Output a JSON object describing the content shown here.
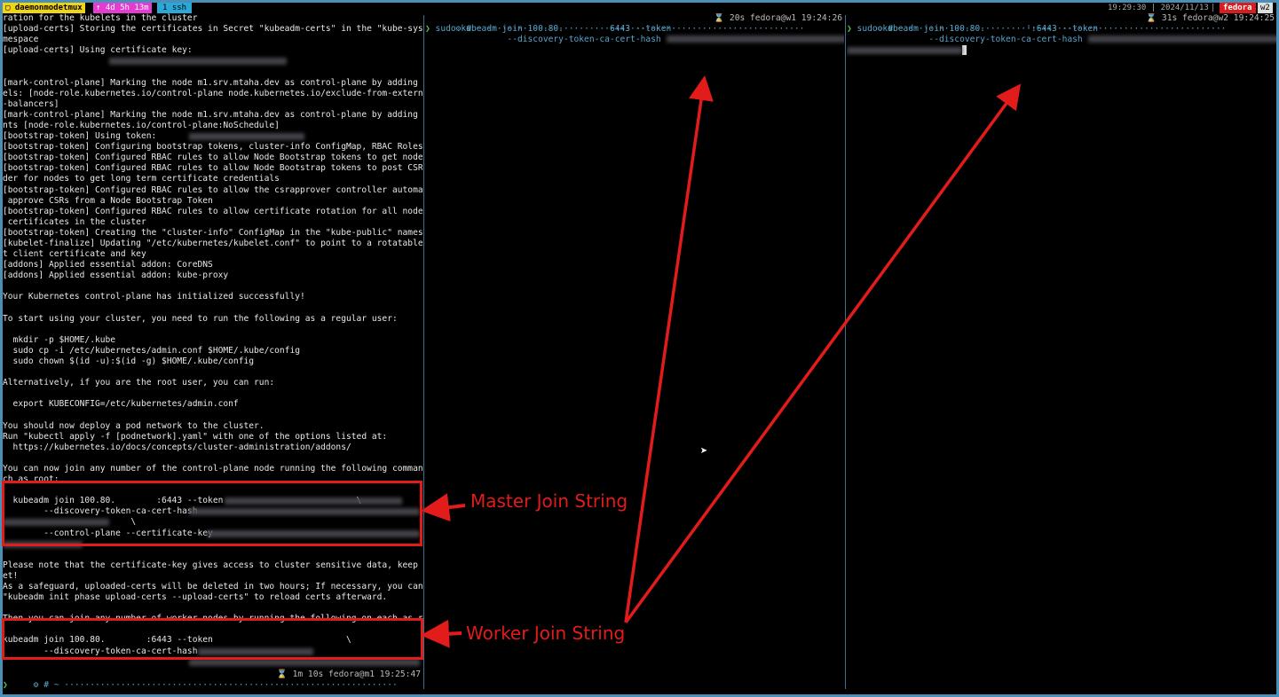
{
  "status_bar": {
    "session": "▢ daemonmodetmux",
    "uptime": "↑ 4d 5h 13m",
    "window": "1 ssh",
    "time": "19:29:30 | 2024/11/13",
    "separator": "|",
    "host": "fedora",
    "window2": "w2"
  },
  "left_pane": {
    "lines": [
      "ration for the kubelets in the cluster",
      "[upload-certs] Storing the certificates in Secret \"kubeadm-certs\" in the \"kube-system\" Na",
      "mespace",
      "[upload-certs] Using certificate key:",
      "",
      "",
      "[mark-control-plane] Marking the node m1.srv.mtaha.dev as control-plane by adding the lab",
      "els: [node-role.kubernetes.io/control-plane node.kubernetes.io/exclude-from-external-load",
      "-balancers]",
      "[mark-control-plane] Marking the node m1.srv.mtaha.dev as control-plane by adding the tai",
      "nts [node-role.kubernetes.io/control-plane:NoSchedule]",
      "[bootstrap-token] Using token:",
      "[bootstrap-token] Configuring bootstrap tokens, cluster-info ConfigMap, RBAC Roles",
      "[bootstrap-token] Configured RBAC rules to allow Node Bootstrap tokens to get nodes",
      "[bootstrap-token] Configured RBAC rules to allow Node Bootstrap tokens to post CSRs in or",
      "der for nodes to get long term certificate credentials",
      "[bootstrap-token] Configured RBAC rules to allow the csrapprover controller automatically",
      " approve CSRs from a Node Bootstrap Token",
      "[bootstrap-token] Configured RBAC rules to allow certificate rotation for all node client",
      " certificates in the cluster",
      "[bootstrap-token] Creating the \"cluster-info\" ConfigMap in the \"kube-public\" namespace",
      "[kubelet-finalize] Updating \"/etc/kubernetes/kubelet.conf\" to point to a rotatable kubele",
      "t client certificate and key",
      "[addons] Applied essential addon: CoreDNS",
      "[addons] Applied essential addon: kube-proxy",
      "",
      "Your Kubernetes control-plane has initialized successfully!",
      "",
      "To start using your cluster, you need to run the following as a regular user:",
      "",
      "  mkdir -p $HOME/.kube",
      "  sudo cp -i /etc/kubernetes/admin.conf $HOME/.kube/config",
      "  sudo chown $(id -u):$(id -g) $HOME/.kube/config",
      "",
      "Alternatively, if you are the root user, you can run:",
      "",
      "  export KUBECONFIG=/etc/kubernetes/admin.conf",
      "",
      "You should now deploy a pod network to the cluster.",
      "Run \"kubectl apply -f [podnetwork].yaml\" with one of the options listed at:",
      "  https://kubernetes.io/docs/concepts/cluster-administration/addons/",
      "",
      "You can now join any number of the control-plane node running the following command on ea",
      "ch as root:",
      "",
      "  kubeadm join 100.80.        :6443 --token                          \\",
      "        --discovery-token-ca-cert-hash",
      "                         \\",
      "        --control-plane --certificate-key",
      "",
      "",
      "Please note that the certificate-key gives access to cluster sensitive data, keep it secr",
      "et!",
      "As a safeguard, uploaded-certs will be deleted in two hours; If necessary, you can use",
      "\"kubeadm init phase upload-certs --upload-certs\" to reload certs afterward.",
      "",
      "Then you can join any number of worker nodes by running the following on each as root:",
      "",
      "kubeadm join 100.80.        :6443 --token                          \\",
      "        --discovery-token-ca-cert-hash",
      ""
    ],
    "prompt_left": "⚙ # ~ ·································································",
    "prompt_right": "⌛ 1m 10s fedora@m1 19:25:47",
    "chevron": "❯"
  },
  "mid_pane": {
    "prompt_left": "⚙ # ~ ······························································",
    "prompt_right": "⌛ 20s fedora@w1 19:24:26",
    "chevron": "❯",
    "cmd1": " sudo kubeadm join 100.80.         6443 --token                                     \\",
    "cmd2": "                --discovery-token-ca-cert-hash"
  },
  "right_pane": {
    "prompt_left": "⚙ # ~ ······························································",
    "prompt_right": "⌛ 31s fedora@w2 19:24:25",
    "chevron": "❯",
    "cmd1": " sudo kubeadm join 100.80.        ':6443 --token                                     \\",
    "cmd2": "                --discovery-token-ca-cert-hash"
  },
  "annotations": {
    "master": "Master Join String",
    "worker": "Worker Join String"
  },
  "colors": {
    "highlight": "#e21b1b",
    "session_bg": "#f2d417",
    "uptime_bg": "#e43bd0",
    "window_bg": "#2aa8d8",
    "host_bg": "#d91c1c"
  }
}
